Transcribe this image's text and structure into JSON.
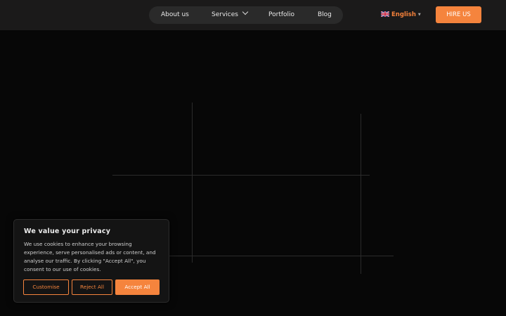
{
  "nav": {
    "items": [
      {
        "label": "About us"
      },
      {
        "label": "Services"
      },
      {
        "label": "Portfolio"
      },
      {
        "label": "Blog"
      }
    ]
  },
  "language": {
    "selected": "English",
    "flag_icon": "uk-flag-icon",
    "caret_icon": "caret-down-icon"
  },
  "header": {
    "hire_label": "HIRE US"
  },
  "cookie": {
    "title": "We value your privacy",
    "text": "We use cookies to enhance your browsing experience, serve personalised ads or content, and analyse our traffic. By clicking \"Accept All\", you consent to our use of cookies.",
    "customise_label": "Customise",
    "reject_label": "Reject All",
    "accept_label": "Accept All"
  },
  "colors": {
    "accent": "#f5843d",
    "header_bg": "#1b1a1a",
    "page_bg": "#070707"
  }
}
